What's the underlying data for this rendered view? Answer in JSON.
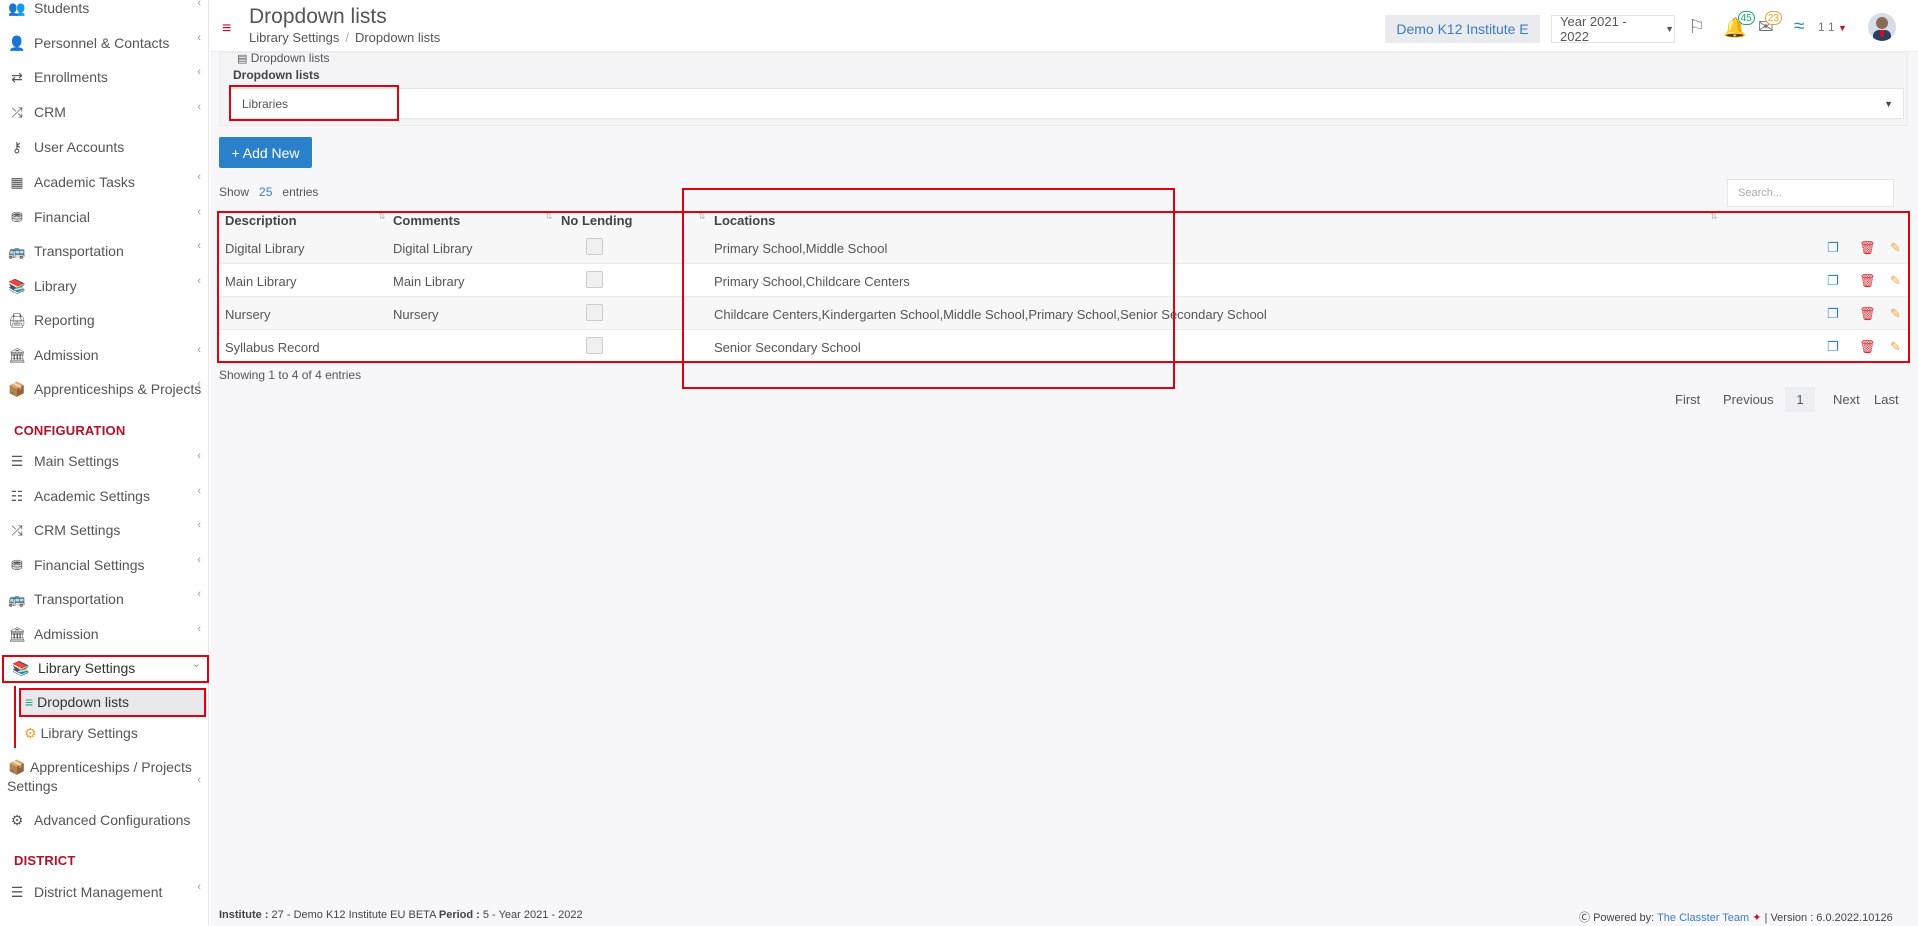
{
  "sidebar": {
    "items": [
      {
        "label": "Students",
        "icon": "users-icon"
      },
      {
        "label": "Personnel & Contacts",
        "icon": "user-tie-icon"
      },
      {
        "label": "Enrollments",
        "icon": "exchange-icon"
      },
      {
        "label": "CRM",
        "icon": "shuffle-icon"
      },
      {
        "label": "User Accounts",
        "icon": "key-icon"
      },
      {
        "label": "Academic Tasks",
        "icon": "grid-icon"
      },
      {
        "label": "Financial",
        "icon": "coins-icon"
      },
      {
        "label": "Transportation",
        "icon": "bus-icon"
      },
      {
        "label": "Library",
        "icon": "books-icon"
      },
      {
        "label": "Reporting",
        "icon": "print-icon"
      },
      {
        "label": "Admission",
        "icon": "bank-icon"
      },
      {
        "label": "Apprenticeships & Projects",
        "icon": "box-icon"
      }
    ],
    "config_section": "CONFIGURATION",
    "config_items": [
      {
        "label": "Main Settings",
        "icon": "sliders-icon"
      },
      {
        "label": "Academic Settings",
        "icon": "sitemap-icon"
      },
      {
        "label": "CRM Settings",
        "icon": "shuffle-icon"
      },
      {
        "label": "Financial Settings",
        "icon": "coins-icon"
      },
      {
        "label": "Transportation",
        "icon": "bus-icon"
      },
      {
        "label": "Admission",
        "icon": "bank-icon"
      },
      {
        "label": "Library Settings",
        "icon": "books-icon"
      }
    ],
    "library_sub": [
      {
        "label": "Dropdown lists",
        "icon": "layers-icon"
      },
      {
        "label": "Library Settings",
        "icon": "gears-icon"
      }
    ],
    "after_items": [
      {
        "label_1": "Apprenticeships / Projects",
        "label_2": "Settings",
        "icon": "box-icon"
      },
      {
        "label": "Advanced Configurations",
        "icon": "gears-icon"
      }
    ],
    "district_section": "DISTRICT",
    "district_items": [
      {
        "label": "District Management",
        "icon": "list-icon"
      }
    ]
  },
  "header": {
    "title": "Dropdown lists",
    "breadcrumb": [
      "Library Settings",
      "Dropdown lists"
    ],
    "institute": "Demo K12 Institute E",
    "year": "Year 2021 - 2022",
    "notifications_count": "45",
    "messages_count": "23",
    "user_label": "1 1"
  },
  "panel": {
    "caption": "Dropdown lists",
    "label": "Dropdown lists",
    "selected": "Libraries"
  },
  "toolbar": {
    "add_label": "+ Add New",
    "show_label": "Show",
    "page_size": "25",
    "entries_label": "entries",
    "search_placeholder": "Search..."
  },
  "table": {
    "columns": [
      "Description",
      "Comments",
      "No Lending",
      "Locations"
    ],
    "rows": [
      {
        "description": "Digital Library",
        "comments": "Digital Library",
        "locations": "Primary School,Middle School"
      },
      {
        "description": "Main Library",
        "comments": "Main Library",
        "locations": "Primary School,Childcare Centers"
      },
      {
        "description": "Nursery",
        "comments": "Nursery",
        "locations": "Childcare Centers,Kindergarten School,Middle School,Primary School,Senior Secondary School"
      },
      {
        "description": "Syllabus Record",
        "comments": "",
        "locations": "Senior Secondary School"
      }
    ],
    "showing": "Showing 1 to 4 of 4 entries"
  },
  "pagination": {
    "first": "First",
    "previous": "Previous",
    "page": "1",
    "next": "Next",
    "last": "Last"
  },
  "footer": {
    "institute_label": "Institute :",
    "institute_value": " 27 - Demo K12 Institute EU BETA ",
    "period_label": "Period :",
    "period_value": " 5 - Year 2021 - 2022",
    "powered_by": "Powered by:",
    "team": "The Classter Team",
    "version": "| Version : 6.0.2022.10126"
  },
  "colors": {
    "accent": "#2a80c9",
    "brand_red": "#c8102e",
    "highlight_box": "#e3000f"
  }
}
